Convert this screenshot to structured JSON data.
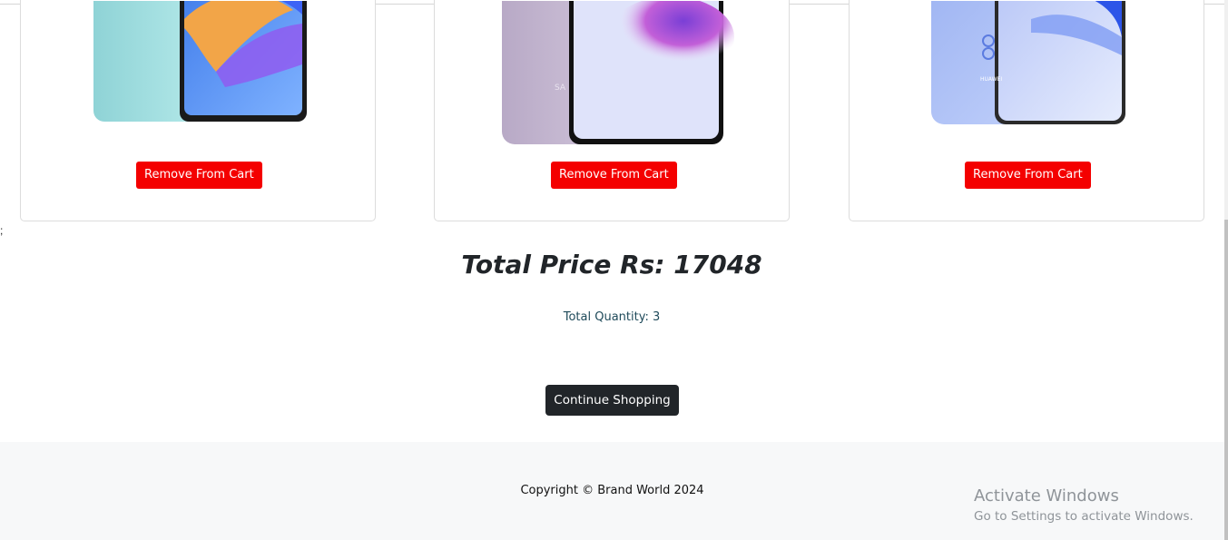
{
  "cart": {
    "items": [
      {
        "remove_label": "Remove From Cart"
      },
      {
        "remove_label": "Remove From Cart",
        "brand_mark": "SA"
      },
      {
        "remove_label": "Remove From Cart",
        "brand_mark": "HUAWEI"
      }
    ]
  },
  "stray_text": ";",
  "summary": {
    "total_price": "Total Price Rs: 17048",
    "total_quantity": "Total Quantity: 3",
    "continue_label": "Continue Shopping"
  },
  "footer": {
    "copyright": "Copyright © Brand World 2024"
  },
  "os_overlay": {
    "title": "Activate Windows",
    "subtitle": "Go to Settings to activate Windows."
  },
  "colors": {
    "remove_button": "#f40000",
    "continue_button": "#212529",
    "footer_bg": "#f7f8f9"
  }
}
